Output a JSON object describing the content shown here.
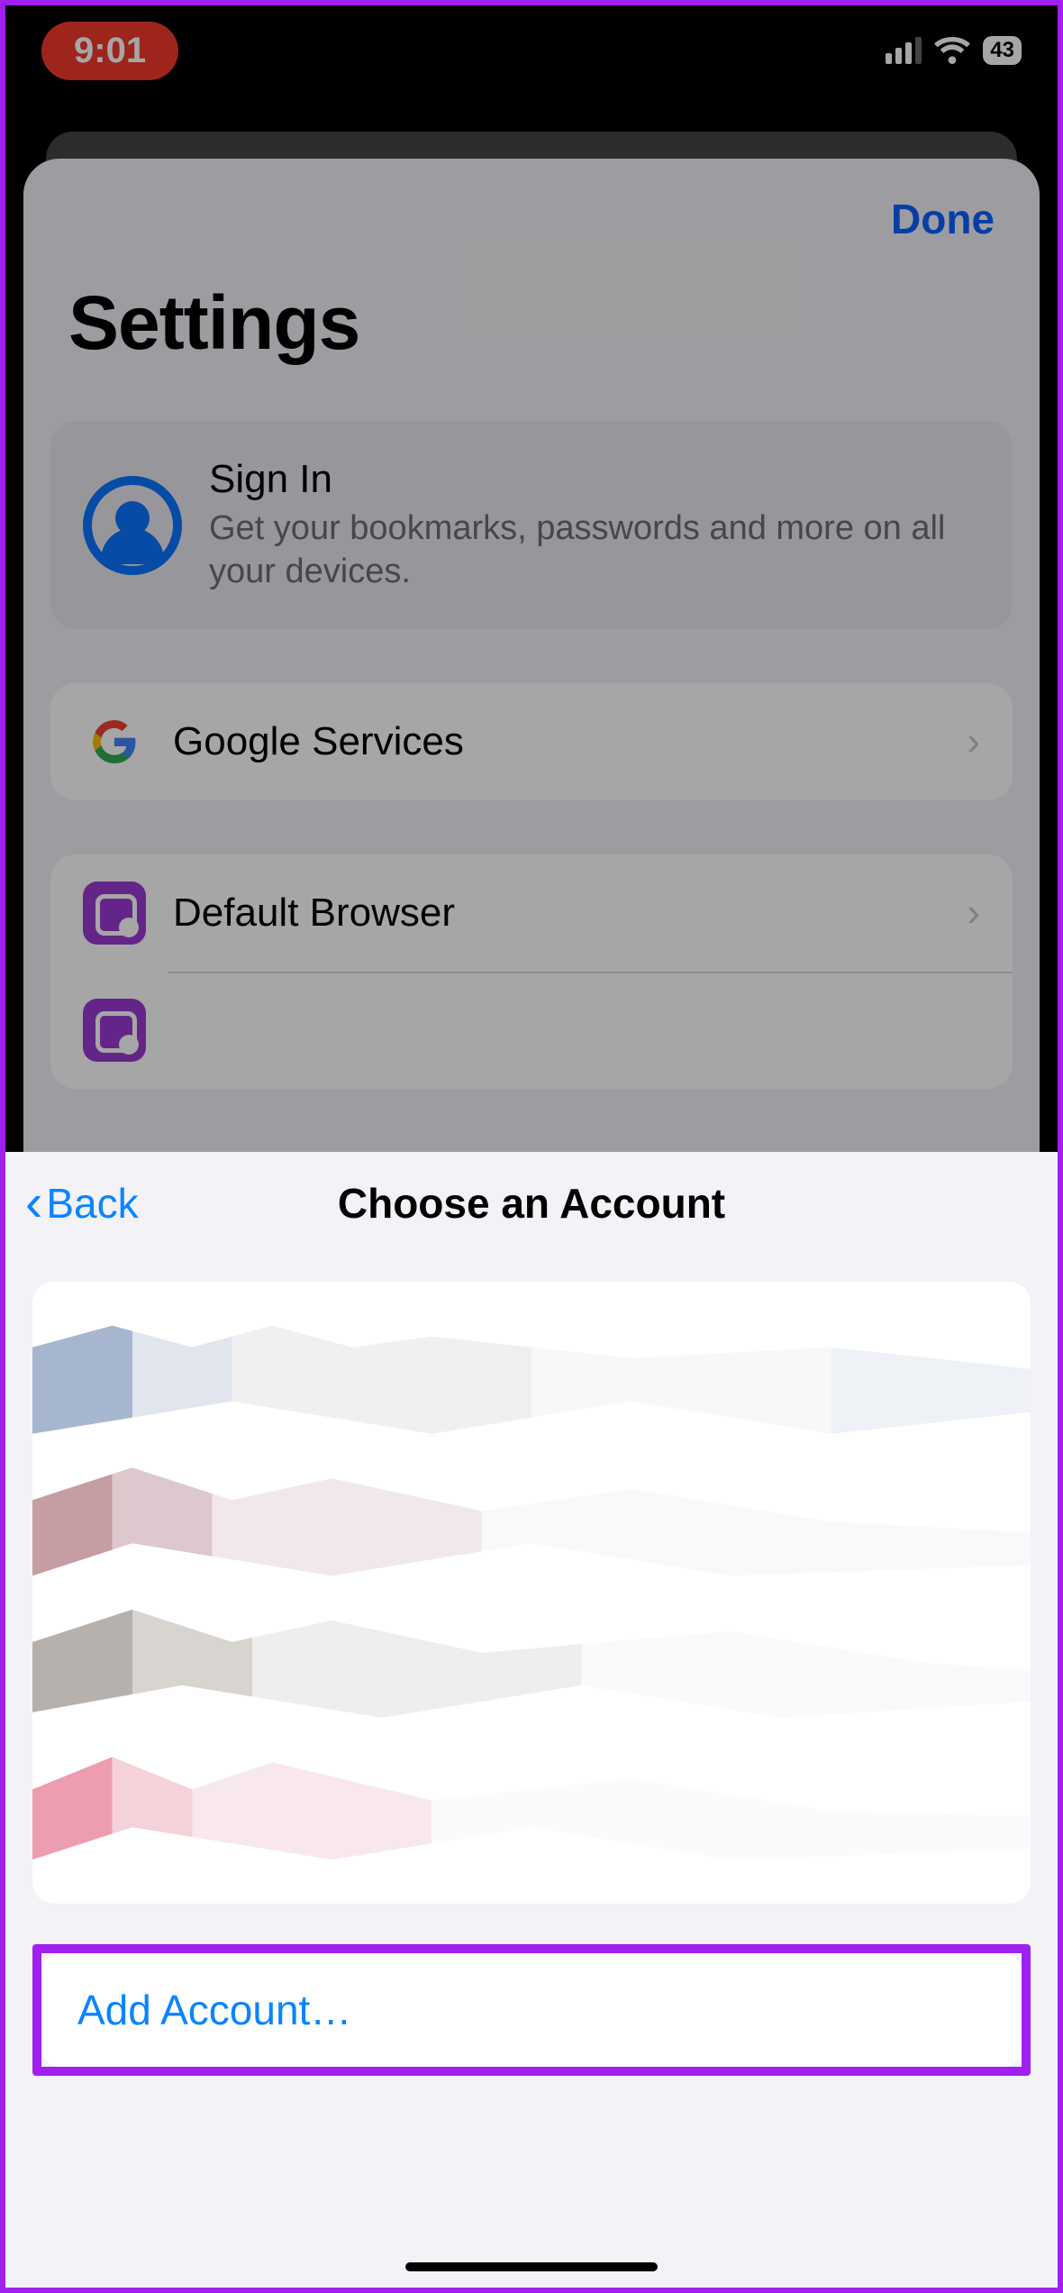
{
  "status": {
    "time": "9:01",
    "battery": "43"
  },
  "settings": {
    "done": "Done",
    "title": "Settings",
    "signin": {
      "title": "Sign In",
      "subtitle": "Get your bookmarks, passwords and more on all your devices."
    },
    "rows": {
      "google_services": "Google Services",
      "default_browser": "Default Browser"
    }
  },
  "modal": {
    "back": "Back",
    "title": "Choose an Account",
    "add_account": "Add Account…"
  }
}
